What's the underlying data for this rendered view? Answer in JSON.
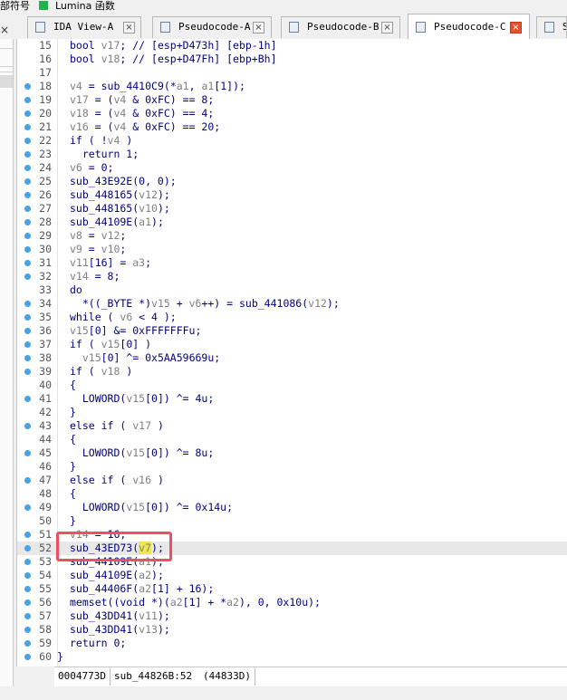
{
  "topbar": {
    "text_left": "部符号",
    "text_right": "Lumina 函数"
  },
  "tabs": [
    {
      "label": "IDA View-A",
      "active": false
    },
    {
      "label": "Pseudocode-A",
      "active": false
    },
    {
      "label": "Pseudocode-B",
      "active": false
    },
    {
      "label": "Pseudocode-C",
      "active": true
    },
    {
      "label": "S",
      "active": false
    }
  ],
  "left_close": "×",
  "code_lines": [
    {
      "n": "15",
      "dot": false,
      "t": "bool v17; // [esp+D473h] [ebp-1h]"
    },
    {
      "n": "16",
      "dot": false,
      "t": "bool v18; // [esp+D47Fh] [ebp+Bh]"
    },
    {
      "n": "17",
      "dot": false,
      "t": ""
    },
    {
      "n": "18",
      "dot": true,
      "t": "v4 = sub_4410C9(*a1, a1[1]);"
    },
    {
      "n": "19",
      "dot": true,
      "t": "v17 = (v4 & 0xFC) == 8;"
    },
    {
      "n": "20",
      "dot": true,
      "t": "v18 = (v4 & 0xFC) == 4;"
    },
    {
      "n": "21",
      "dot": true,
      "t": "v16 = (v4 & 0xFC) == 20;"
    },
    {
      "n": "22",
      "dot": true,
      "t": "if ( !v4 )"
    },
    {
      "n": "23",
      "dot": true,
      "t": "  return 1;"
    },
    {
      "n": "24",
      "dot": true,
      "t": "v6 = 0;"
    },
    {
      "n": "25",
      "dot": true,
      "t": "sub_43E92E(0, 0);"
    },
    {
      "n": "26",
      "dot": true,
      "t": "sub_448165(v12);"
    },
    {
      "n": "27",
      "dot": true,
      "t": "sub_448165(v10);"
    },
    {
      "n": "28",
      "dot": true,
      "t": "sub_44109E(a1);"
    },
    {
      "n": "29",
      "dot": true,
      "t": "v8 = v12;"
    },
    {
      "n": "30",
      "dot": true,
      "t": "v9 = v10;"
    },
    {
      "n": "31",
      "dot": true,
      "t": "v11[16] = a3;"
    },
    {
      "n": "32",
      "dot": true,
      "t": "v14 = 8;"
    },
    {
      "n": "33",
      "dot": false,
      "t": "do"
    },
    {
      "n": "34",
      "dot": true,
      "t": "  *((_BYTE *)v15 + v6++) = sub_441086(v12);"
    },
    {
      "n": "35",
      "dot": true,
      "t": "while ( v6 < 4 );"
    },
    {
      "n": "36",
      "dot": true,
      "t": "v15[0] &= 0xFFFFFFFu;"
    },
    {
      "n": "37",
      "dot": true,
      "t": "if ( v15[0] )"
    },
    {
      "n": "38",
      "dot": true,
      "t": "  v15[0] ^= 0x5AA59669u;"
    },
    {
      "n": "39",
      "dot": true,
      "t": "if ( v18 )"
    },
    {
      "n": "40",
      "dot": false,
      "t": "{"
    },
    {
      "n": "41",
      "dot": true,
      "t": "  LOWORD(v15[0]) ^= 4u;"
    },
    {
      "n": "42",
      "dot": false,
      "t": "}"
    },
    {
      "n": "43",
      "dot": true,
      "t": "else if ( v17 )"
    },
    {
      "n": "44",
      "dot": false,
      "t": "{"
    },
    {
      "n": "45",
      "dot": true,
      "t": "  LOWORD(v15[0]) ^= 8u;"
    },
    {
      "n": "46",
      "dot": false,
      "t": "}"
    },
    {
      "n": "47",
      "dot": true,
      "t": "else if ( v16 )"
    },
    {
      "n": "48",
      "dot": false,
      "t": "{"
    },
    {
      "n": "49",
      "dot": true,
      "t": "  LOWORD(v15[0]) ^= 0x14u;"
    },
    {
      "n": "50",
      "dot": false,
      "t": "}"
    },
    {
      "n": "51",
      "dot": true,
      "t": "v14 = 16;"
    },
    {
      "n": "52",
      "dot": true,
      "t": "sub_43ED73(v7);"
    },
    {
      "n": "53",
      "dot": true,
      "t": "sub_44109E(a1);"
    },
    {
      "n": "54",
      "dot": true,
      "t": "sub_44109E(a2);"
    },
    {
      "n": "55",
      "dot": true,
      "t": "sub_44406F(a2[1] + 16);"
    },
    {
      "n": "56",
      "dot": true,
      "t": "memset((void *)(a2[1] + *a2), 0, 0x10u);"
    },
    {
      "n": "57",
      "dot": true,
      "t": "sub_43DD41(v11);"
    },
    {
      "n": "58",
      "dot": true,
      "t": "sub_43DD41(v13);"
    },
    {
      "n": "59",
      "dot": true,
      "t": "return 0;"
    },
    {
      "n": "60",
      "dot": true,
      "t": "}"
    }
  ],
  "highlight_line": "52",
  "highlight_token": "v7",
  "status": {
    "address": "0004773D",
    "location": "sub_44826B:52",
    "offset": "(44833D)"
  },
  "colors": {
    "code": "#000080",
    "variable": "#808080",
    "dot": "#45a3e8",
    "redbox": "#ee4f63",
    "token_highlight": "#f0e84a"
  }
}
